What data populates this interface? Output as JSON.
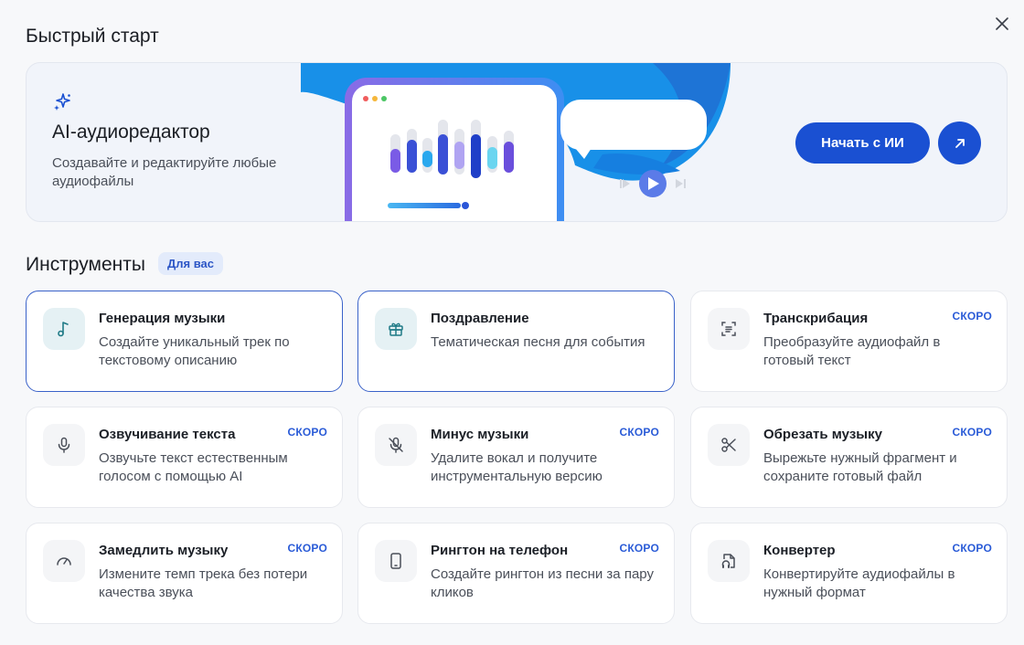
{
  "dialog": {
    "title": "Быстрый старт",
    "close_icon": "close-icon"
  },
  "hero": {
    "icon": "sparkle-icon",
    "title": "AI-аудиоредактор",
    "description": "Создавайте и редактируйте любые аудиофайлы",
    "cta_label": "Начать с ИИ",
    "arrow_icon": "arrow-up-right-icon",
    "accent_color": "#1a50d2"
  },
  "tools": {
    "title": "Инструменты",
    "badge": "Для вас",
    "soon_label": "СКОРО",
    "items": [
      {
        "name": "music-generation",
        "icon": "music-note-icon",
        "title": "Генерация музыки",
        "description": "Создайте уникальный трек по текстовому описанию",
        "soon": false,
        "active": true
      },
      {
        "name": "greeting",
        "icon": "gift-icon",
        "title": "Поздравление",
        "description": "Тематическая песня для события",
        "soon": false,
        "active": true
      },
      {
        "name": "transcription",
        "icon": "transcribe-icon",
        "title": "Транскрибация",
        "description": "Преобразуйте аудиофайл в готовый текст",
        "soon": true,
        "active": false
      },
      {
        "name": "text-to-speech",
        "icon": "microphone-icon",
        "title": "Озвучивание текста",
        "description": "Озвучьте текст естественным голосом с помощью AI",
        "soon": true,
        "active": false
      },
      {
        "name": "vocal-remover",
        "icon": "mic-off-icon",
        "title": "Минус музыки",
        "description": "Удалите вокал и получите инструментальную версию",
        "soon": true,
        "active": false
      },
      {
        "name": "cut-music",
        "icon": "scissors-icon",
        "title": "Обрезать музыку",
        "description": "Вырежьте нужный фрагмент и сохраните готовый файл",
        "soon": true,
        "active": false
      },
      {
        "name": "slow-music",
        "icon": "speedometer-icon",
        "title": "Замедлить музыку",
        "description": "Измените темп трека без потери качества звука",
        "soon": true,
        "active": false
      },
      {
        "name": "ringtone",
        "icon": "phone-icon",
        "title": "Рингтон на телефон",
        "description": "Создайте рингтон из песни за пару кликов",
        "soon": true,
        "active": false
      },
      {
        "name": "converter",
        "icon": "audio-file-icon",
        "title": "Конвертер",
        "description": "Конвертируйте аудиофайлы в нужный формат",
        "soon": true,
        "active": false
      }
    ]
  }
}
